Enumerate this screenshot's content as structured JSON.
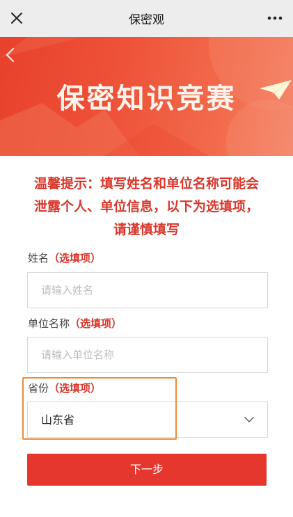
{
  "nav": {
    "title": "保密观",
    "close_icon": "close-icon",
    "more_icon": "more-icon"
  },
  "banner": {
    "title": "保密知识竞赛",
    "back_icon": "chevron-left-icon",
    "decoration_icon": "paper-plane-icon"
  },
  "notice": {
    "line1": "温馨提示：填写姓名和单位名称可能会",
    "line2": "泄露个人、单位信息，以下为选填项，",
    "line3": "请谨慎填写"
  },
  "form": {
    "name": {
      "label": "姓名",
      "optional": "（选填项）",
      "placeholder": "请输入姓名",
      "value": ""
    },
    "unit": {
      "label": "单位名称",
      "optional": "（选填项）",
      "placeholder": "请输入单位名称",
      "value": ""
    },
    "province": {
      "label": "省份",
      "optional": "（选填项）",
      "value": "山东省"
    }
  },
  "next_button": "下一步",
  "colors": {
    "accent": "#e5372d",
    "notice": "#d9362b",
    "highlight": "#ef8a3a",
    "nav_bg": "#ededed"
  }
}
